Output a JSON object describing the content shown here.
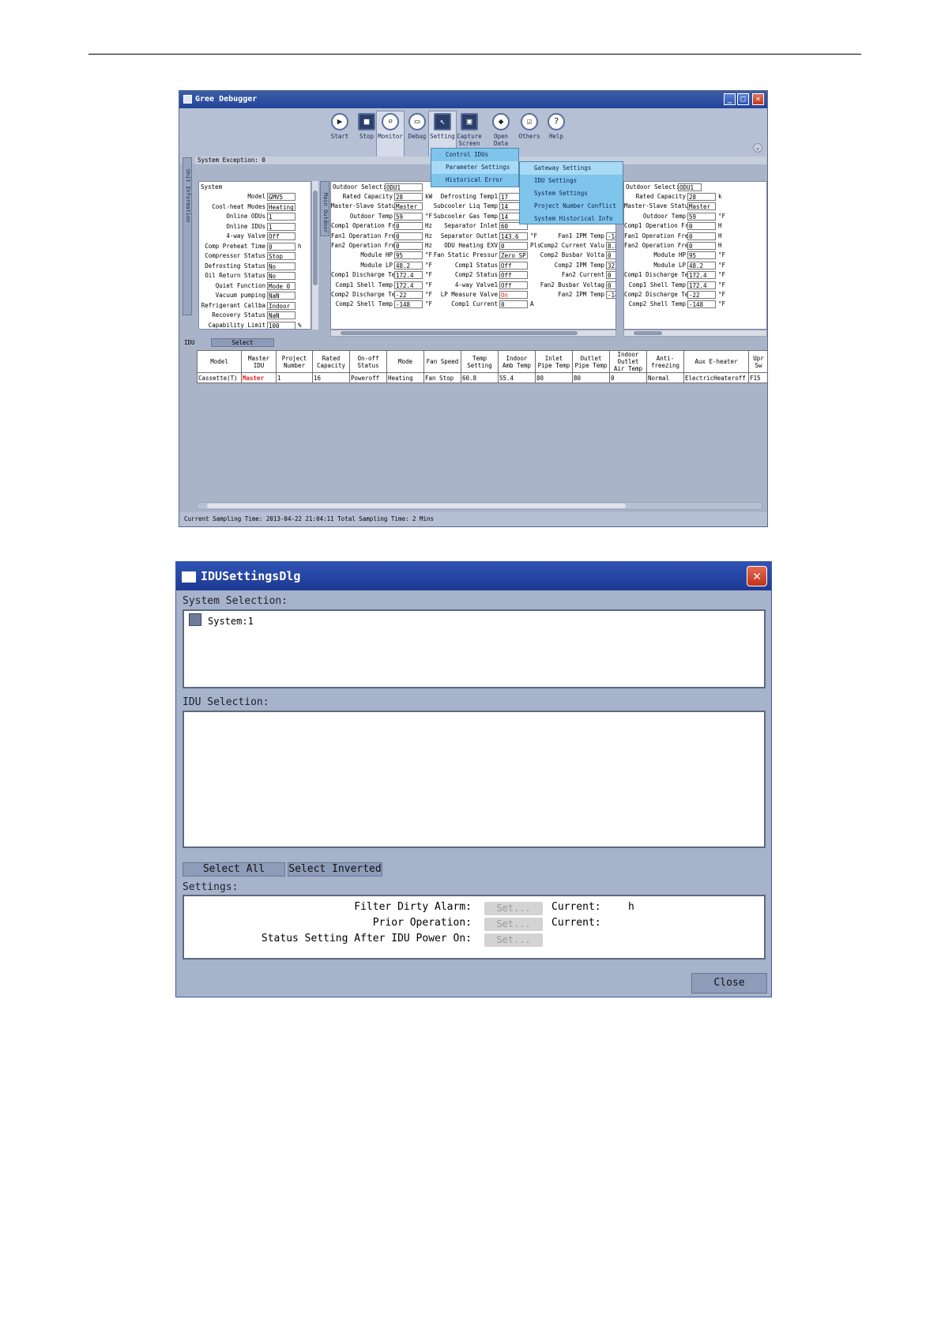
{
  "debugger": {
    "title": "Gree Debugger",
    "toolbar": [
      {
        "label": "Start",
        "icon": "start-icon",
        "glyph": "▶"
      },
      {
        "label": "Stop",
        "icon": "stop-icon",
        "glyph": "■"
      },
      {
        "label": "Monitor",
        "icon": "monitor-icon",
        "glyph": "⌕"
      },
      {
        "label": "Debug",
        "icon": "debug-icon",
        "glyph": "▭"
      },
      {
        "label": "Setting",
        "icon": "setting-icon",
        "glyph": "↖"
      },
      {
        "label": "Capture Screen",
        "icon": "capture-icon",
        "glyph": "▣"
      },
      {
        "label": "Open Data Folder",
        "icon": "folder-icon",
        "glyph": "◆"
      },
      {
        "label": "Others",
        "icon": "others-icon",
        "glyph": "☑"
      },
      {
        "label": "Help",
        "icon": "help-icon",
        "glyph": "?"
      }
    ],
    "system_exception": "System Exception: 0",
    "unit_information_tab": "Unit Information",
    "main_outdoor_tab": "Main Outdoor",
    "system_panel": {
      "header": "System",
      "rows": [
        {
          "label": "Model",
          "value": "GMV5",
          "unit": ""
        },
        {
          "label": "Cool-heat Modes",
          "value": "Heating O",
          "unit": ""
        },
        {
          "label": "Online ODUs",
          "value": "1",
          "unit": ""
        },
        {
          "label": "Online IDUs",
          "value": "1",
          "unit": ""
        },
        {
          "label": "4-way Valve",
          "value": "Off",
          "unit": ""
        },
        {
          "label": "Comp Preheat Time",
          "value": "0",
          "unit": "h"
        },
        {
          "label": "Compressor Status",
          "value": "Stop",
          "unit": ""
        },
        {
          "label": "Defrosting Status",
          "value": "No",
          "unit": ""
        },
        {
          "label": "Oil Return Status",
          "value": "No",
          "unit": ""
        },
        {
          "label": "Quiet Function",
          "value": "Mode 0",
          "unit": ""
        },
        {
          "label": "Vacuum pumping",
          "value": "NaN",
          "unit": ""
        },
        {
          "label": "Refrigerant Callba",
          "value": "Indoor re",
          "unit": ""
        },
        {
          "label": "Recovery Status",
          "value": "NaN",
          "unit": ""
        },
        {
          "label": "Capability Limit",
          "value": "100",
          "unit": "%"
        }
      ]
    },
    "outdoor_select_label": "Outdoor Select:",
    "outdoor_select_value": "ODU1",
    "odu_col1": [
      {
        "label": "Rated Capacity",
        "value": "28",
        "unit": "kW"
      },
      {
        "label": "Master-Slave Statu",
        "value": "Master",
        "unit": ""
      },
      {
        "label": "Outdoor Temp",
        "value": "59",
        "unit": "°F"
      },
      {
        "label": "Comp1 Operation Fr",
        "value": "0",
        "unit": "Hz"
      },
      {
        "label": "Fan1 Operation Fre",
        "value": "0",
        "unit": "Hz"
      },
      {
        "label": "Fan2 Operation Fre",
        "value": "0",
        "unit": "Hz"
      },
      {
        "label": "Module HP",
        "value": "95",
        "unit": "°F"
      },
      {
        "label": "Module LP",
        "value": "48.2",
        "unit": "°F"
      },
      {
        "label": "Comp1 Discharge Te",
        "value": "172.4",
        "unit": "°F"
      },
      {
        "label": "Comp1 Shell Temp",
        "value": "172.4",
        "unit": "°F"
      },
      {
        "label": "Comp2 Discharge Te",
        "value": "-22",
        "unit": "°F"
      },
      {
        "label": "Comp2 Shell Temp",
        "value": "-148",
        "unit": "°F"
      }
    ],
    "odu_col2": [
      {
        "label": "Defrosting Temp1",
        "value": "17",
        "unit": ""
      },
      {
        "label": "Subcooler Liq Temp",
        "value": "14",
        "unit": ""
      },
      {
        "label": "Subcooler Gas Temp",
        "value": "14",
        "unit": ""
      },
      {
        "label": "Separator Inlet",
        "value": "60",
        "unit": ""
      },
      {
        "label": "Separator Outlet",
        "value": "143.6",
        "unit": "°F"
      },
      {
        "label": "ODU Heating EXV",
        "value": "0",
        "unit": "Pls"
      },
      {
        "label": "Fan Static Pressur",
        "value": "Zero SP",
        "unit": ""
      },
      {
        "label": "Comp1 Status",
        "value": "Off",
        "unit": ""
      },
      {
        "label": "Comp2 Status",
        "value": "Off",
        "unit": ""
      },
      {
        "label": "4-way Valve1",
        "value": "Off",
        "unit": ""
      },
      {
        "label": "LP Measure Valve",
        "value": "On",
        "unit": ""
      },
      {
        "label": "Comp1 Current",
        "value": "0",
        "unit": "A"
      }
    ],
    "odu_col3": [
      {
        "label": "",
        "value": "",
        "unit": ""
      },
      {
        "label": "",
        "value": "-148",
        "unit": ""
      },
      {
        "label": "",
        "value": "",
        "unit": ""
      },
      {
        "label": "",
        "value": "",
        "unit": ""
      },
      {
        "label": "Fan1 IPM Temp",
        "value": "-148",
        "unit": ""
      },
      {
        "label": "Comp2 Current Valu",
        "value": "8.8",
        "unit": ""
      },
      {
        "label": "Comp2 Busbar Volta",
        "value": "0",
        "unit": ""
      },
      {
        "label": "Comp2 IPM Temp",
        "value": "32",
        "unit": ""
      },
      {
        "label": "Fan2 Current",
        "value": "0",
        "unit": ""
      },
      {
        "label": "Fan2 Busbar Voltag",
        "value": "0",
        "unit": ""
      },
      {
        "label": "Fan2 IPM Temp",
        "value": "-148",
        "unit": ""
      },
      {
        "label": "",
        "value": "",
        "unit": ""
      }
    ],
    "outdoor_select2_label": "Outdoor Select:",
    "outdoor_select2_value": "ODU1",
    "odu2_rows": [
      {
        "label": "Rated Capacity",
        "value": "28",
        "unit": "k"
      },
      {
        "label": "Master-Slave Statu",
        "value": "Master",
        "unit": ""
      },
      {
        "label": "Outdoor Temp",
        "value": "59",
        "unit": "°F"
      },
      {
        "label": "Comp1 Operation Fr",
        "value": "0",
        "unit": "H"
      },
      {
        "label": "Fan1 Operation Fre",
        "value": "0",
        "unit": "H"
      },
      {
        "label": "Fan2 Operation Fre",
        "value": "0",
        "unit": "H"
      },
      {
        "label": "Module HP",
        "value": "95",
        "unit": "°F"
      },
      {
        "label": "Module LP",
        "value": "48.2",
        "unit": "°F"
      },
      {
        "label": "Comp1 Discharge Te",
        "value": "172.4",
        "unit": "°F"
      },
      {
        "label": "Comp1 Shell Temp",
        "value": "172.4",
        "unit": "°F"
      },
      {
        "label": "Comp2 Discharge Te",
        "value": "-22",
        "unit": "°F"
      },
      {
        "label": "Comp2 Shell Temp",
        "value": "-148",
        "unit": "°F"
      }
    ],
    "setting_menu": [
      "Control IDUs",
      "Parameter Settings",
      "Historical Error"
    ],
    "param_submenu": [
      "Gateway Settings",
      "IDU Settings",
      "System Settings",
      "Project Number Conflict",
      "System Historical Info"
    ],
    "idu_label": "IDU",
    "idu_select_button": "Select",
    "idu_table": {
      "headers": [
        "Model",
        "Master IDU",
        "Project Number",
        "Rated Capacity",
        "On-off Status",
        "Mode",
        "Fan Speed",
        "Temp Setting",
        "Indoor Amb Temp",
        "Inlet Pipe Temp",
        "Outlet Pipe Temp",
        "Indoor Outlet Air Temp",
        "Anti-freezing",
        "Aux E-heater",
        "Upr Sw"
      ],
      "row": [
        "Cassette(T)",
        "Master",
        "1",
        "16",
        "Poweroff",
        "Heating",
        "Fan Stop",
        "60.8",
        "55.4",
        "80",
        "80",
        "0",
        "Normal",
        "ElectricHeateroff",
        "F15"
      ]
    },
    "status_text": "Current Sampling Time: 2013-04-22 21:04:11   Total Sampling Time: 2 Mins",
    "colors": {
      "master_text": "#e02020",
      "menu_blue": "#7fc4ea"
    }
  },
  "dialog": {
    "title": "IDUSettingsDlg",
    "close_glyph": "✕",
    "system_selection_label": "System Selection:",
    "system_item": "System:1",
    "idu_selection_label": "IDU Selection:",
    "select_all": "Select All",
    "select_inverted": "Select Inverted",
    "settings_label": "Settings:",
    "settings": [
      {
        "label": "Filter Dirty Alarm:",
        "button": "Set...",
        "current_label": "Current:",
        "current_unit": "h"
      },
      {
        "label": "Prior Operation:",
        "button": "Set...",
        "current_label": "Current:",
        "current_unit": ""
      },
      {
        "label": "Status Setting After IDU Power On:",
        "button": "Set...",
        "current_label": "",
        "current_unit": ""
      }
    ],
    "close_button": "Close"
  }
}
